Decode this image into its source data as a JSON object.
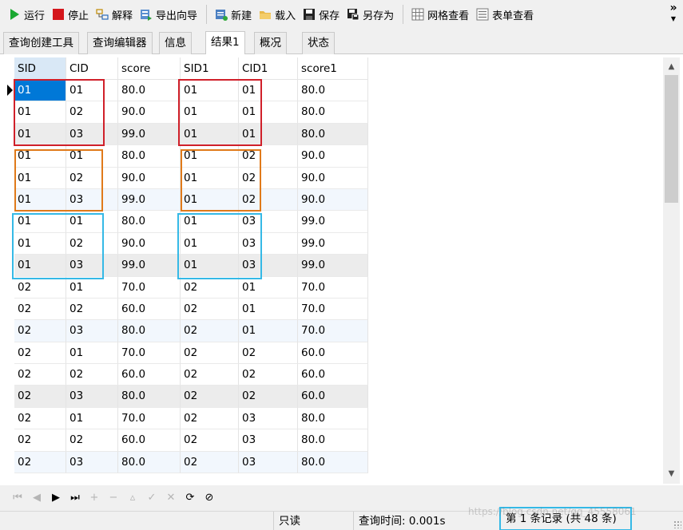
{
  "toolbar": {
    "run": "运行",
    "stop": "停止",
    "explain": "解释",
    "export_wizard": "导出向导",
    "new": "新建",
    "load": "载入",
    "save": "保存",
    "save_as": "另存为",
    "grid_view": "网格查看",
    "form_view": "表单查看",
    "more": "»"
  },
  "tabs": [
    "查询创建工具",
    "查询编辑器",
    "信息",
    "结果1",
    "概况",
    "状态"
  ],
  "active_tab": "结果1",
  "grid": {
    "columns": [
      "SID",
      "CID",
      "score",
      "SID1",
      "CID1",
      "score1"
    ],
    "rows": [
      [
        "01",
        "01",
        "80.0",
        "01",
        "01",
        "80.0"
      ],
      [
        "01",
        "02",
        "90.0",
        "01",
        "01",
        "80.0"
      ],
      [
        "01",
        "03",
        "99.0",
        "01",
        "01",
        "80.0"
      ],
      [
        "01",
        "01",
        "80.0",
        "01",
        "02",
        "90.0"
      ],
      [
        "01",
        "02",
        "90.0",
        "01",
        "02",
        "90.0"
      ],
      [
        "01",
        "03",
        "99.0",
        "01",
        "02",
        "90.0"
      ],
      [
        "01",
        "01",
        "80.0",
        "01",
        "03",
        "99.0"
      ],
      [
        "01",
        "02",
        "90.0",
        "01",
        "03",
        "99.0"
      ],
      [
        "01",
        "03",
        "99.0",
        "01",
        "03",
        "99.0"
      ],
      [
        "02",
        "01",
        "70.0",
        "02",
        "01",
        "70.0"
      ],
      [
        "02",
        "02",
        "60.0",
        "02",
        "01",
        "70.0"
      ],
      [
        "02",
        "03",
        "80.0",
        "02",
        "01",
        "70.0"
      ],
      [
        "02",
        "01",
        "70.0",
        "02",
        "02",
        "60.0"
      ],
      [
        "02",
        "02",
        "60.0",
        "02",
        "02",
        "60.0"
      ],
      [
        "02",
        "03",
        "80.0",
        "02",
        "02",
        "60.0"
      ],
      [
        "02",
        "01",
        "70.0",
        "02",
        "03",
        "80.0"
      ],
      [
        "02",
        "02",
        "60.0",
        "02",
        "03",
        "80.0"
      ],
      [
        "02",
        "03",
        "80.0",
        "02",
        "03",
        "80.0"
      ]
    ],
    "row_styles": [
      "",
      "",
      "gray",
      "",
      "",
      "alt",
      "",
      "",
      "gray",
      "",
      "",
      "alt",
      "",
      "",
      "gray",
      "",
      "",
      "alt"
    ],
    "highlight_colors": {
      "red": "#d0202a",
      "orange": "#e07a1a",
      "blue": "#35b9e6"
    }
  },
  "status": {
    "readonly": "只读",
    "query_time": "查询时间: 0.001s",
    "record": "第 1 条记录 (共 48 条)",
    "watermark": "https://blog.csdn.net/qq_45558061"
  },
  "icons": {
    "run": "play-icon",
    "stop": "stop-icon",
    "explain": "explain-icon",
    "export": "export-icon",
    "new": "new-icon",
    "load": "folder-icon",
    "save": "save-icon",
    "save_as": "save-as-icon",
    "grid": "grid-icon",
    "form": "form-icon"
  }
}
